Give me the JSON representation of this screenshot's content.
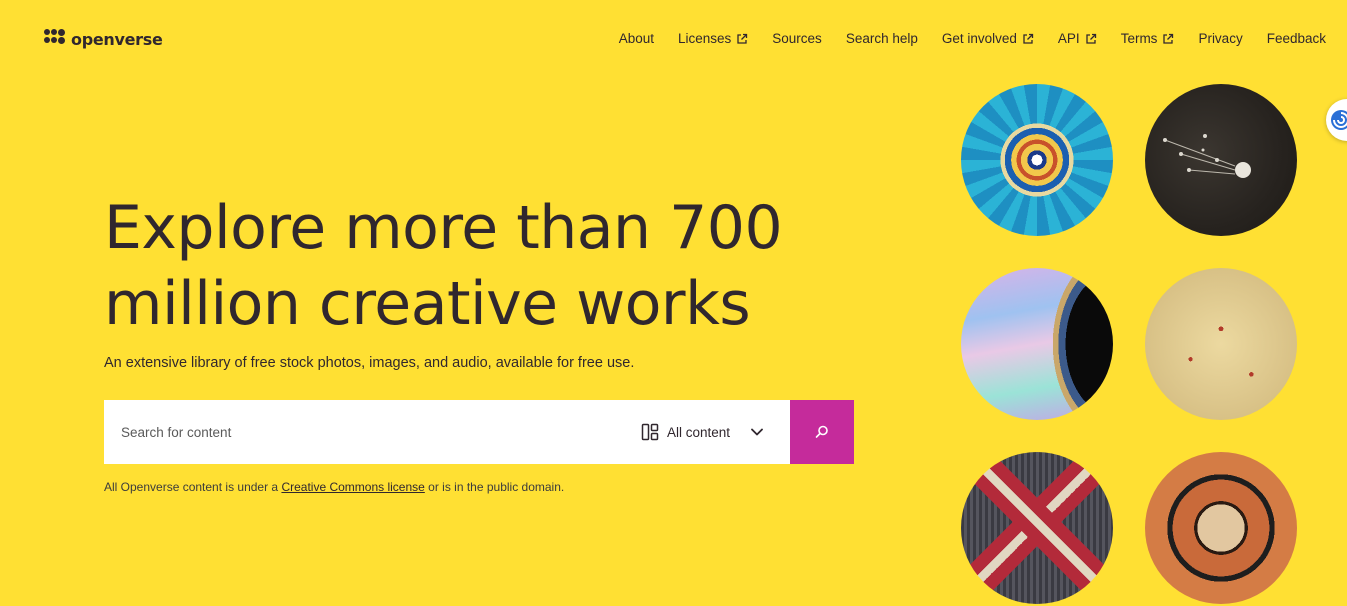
{
  "brand": {
    "logo_text": "openverse",
    "logo_icon": "openverse-dots-icon"
  },
  "nav": {
    "items": [
      {
        "label": "About",
        "external": false
      },
      {
        "label": "Licenses",
        "external": true
      },
      {
        "label": "Sources",
        "external": false
      },
      {
        "label": "Search help",
        "external": false
      },
      {
        "label": "Get involved",
        "external": true
      },
      {
        "label": "API",
        "external": true
      },
      {
        "label": "Terms",
        "external": true
      },
      {
        "label": "Privacy",
        "external": false
      },
      {
        "label": "Feedback",
        "external": false
      }
    ]
  },
  "hero": {
    "headline_line1": "Explore more than 700",
    "headline_line2": "million creative works",
    "subline": "An extensive library of free stock photos, images, and audio, available for free use."
  },
  "search": {
    "placeholder": "Search for content",
    "value": "",
    "content_type": "All content",
    "content_type_icon": "all-content-grid-icon",
    "button_icon": "search-icon"
  },
  "license_note": {
    "before": "All Openverse content is under a ",
    "link": "Creative Commons license",
    "after": " or is in the public domain."
  },
  "gallery": {
    "images": [
      "ornamental tile mandala",
      "comet illustration",
      "planet rings",
      "star chart map",
      "woven textile",
      "circular manuscript"
    ]
  },
  "colors": {
    "background": "#ffe033",
    "text": "#30272e",
    "search_button": "#c52b9b"
  }
}
